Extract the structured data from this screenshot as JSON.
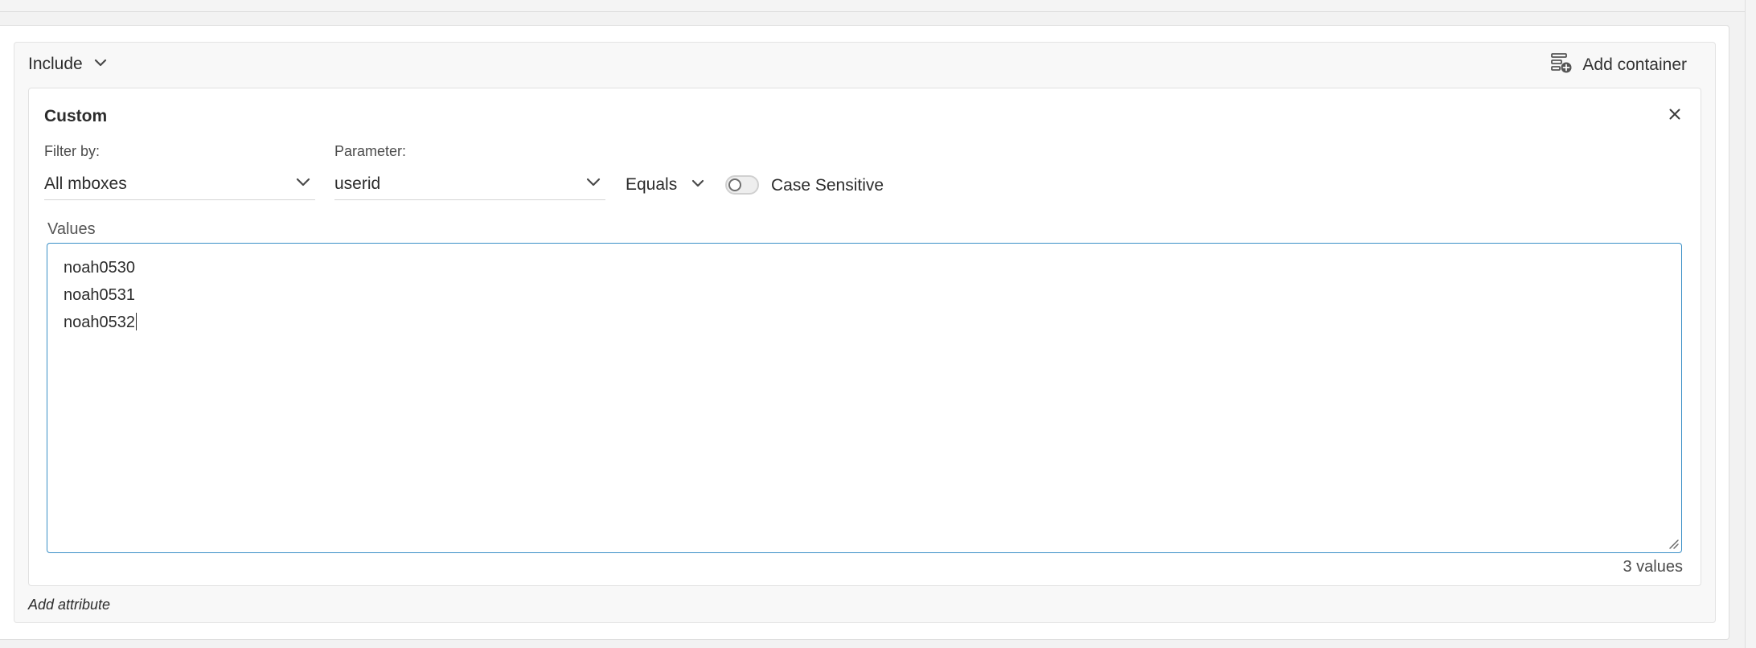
{
  "container": {
    "include_label": "Include",
    "add_container_label": "Add container"
  },
  "custom": {
    "title": "Custom",
    "filter_by": {
      "label": "Filter by:",
      "value": "All mboxes"
    },
    "parameter": {
      "label": "Parameter:",
      "value": "userid"
    },
    "operator": {
      "value": "Equals"
    },
    "case_sensitive": {
      "label": "Case Sensitive",
      "enabled": false
    },
    "values": {
      "label": "Values",
      "items": [
        "noah0530",
        "noah0531",
        "noah0532"
      ],
      "count_label": "3 values"
    }
  },
  "footer": {
    "add_attribute_label": "Add attribute"
  },
  "icons": {
    "include_chevron": "chevron-down-icon",
    "add_container": "add-container-icon",
    "close": "close-icon",
    "filter_chevron": "chevron-down-icon",
    "parameter_chevron": "chevron-down-icon",
    "operator_chevron": "chevron-down-icon"
  },
  "colors": {
    "focus_border": "#3a8fc7",
    "text": "#2c2c2c"
  }
}
